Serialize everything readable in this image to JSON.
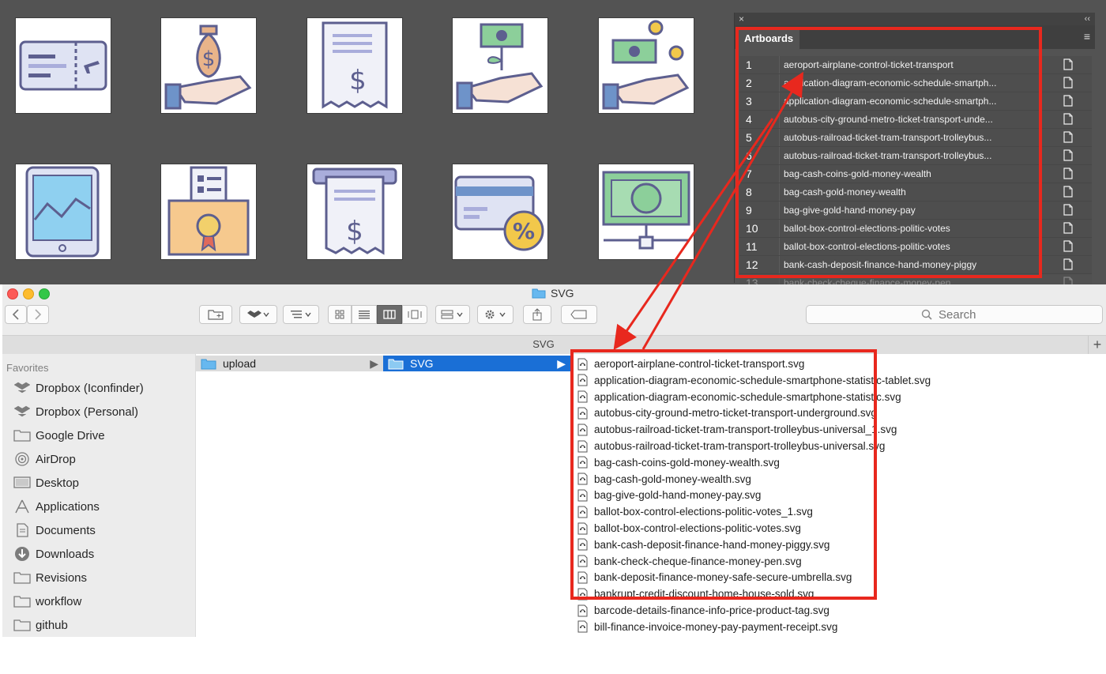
{
  "canvas": {
    "icons": [
      {
        "name": "airplane-ticket-icon"
      },
      {
        "name": "money-bag-hand-icon"
      },
      {
        "name": "receipt-dollar-icon"
      },
      {
        "name": "money-plant-hand-icon"
      },
      {
        "name": "cash-coins-hand-icon"
      },
      {
        "name": "tablet-chart-icon"
      },
      {
        "name": "ballot-box-icon"
      },
      {
        "name": "atm-receipt-icon"
      },
      {
        "name": "credit-card-percent-icon"
      },
      {
        "name": "banknote-icon"
      }
    ]
  },
  "artboards_panel": {
    "close_glyph": "×",
    "collapse_glyph": "‹‹",
    "tab_label": "Artboards",
    "menu_glyph": "≡",
    "rows": [
      {
        "num": "1",
        "name": "aeroport-airplane-control-ticket-transport"
      },
      {
        "num": "2",
        "name": "application-diagram-economic-schedule-smartph..."
      },
      {
        "num": "3",
        "name": "application-diagram-economic-schedule-smartph..."
      },
      {
        "num": "4",
        "name": "autobus-city-ground-metro-ticket-transport-unde..."
      },
      {
        "num": "5",
        "name": "autobus-railroad-ticket-tram-transport-trolleybus..."
      },
      {
        "num": "6",
        "name": "autobus-railroad-ticket-tram-transport-trolleybus..."
      },
      {
        "num": "7",
        "name": "bag-cash-coins-gold-money-wealth"
      },
      {
        "num": "8",
        "name": "bag-cash-gold-money-wealth"
      },
      {
        "num": "9",
        "name": "bag-give-gold-hand-money-pay"
      },
      {
        "num": "10",
        "name": "ballot-box-control-elections-politic-votes"
      },
      {
        "num": "11",
        "name": "ballot-box-control-elections-politic-votes"
      },
      {
        "num": "12",
        "name": "bank-cash-deposit-finance-hand-money-piggy"
      },
      {
        "num": "13",
        "name": "bank-check-cheque-finance-money-pen"
      }
    ]
  },
  "finder": {
    "window_title": "SVG",
    "path_label": "SVG",
    "search_placeholder": "Search",
    "plus_glyph": "+",
    "sidebar": {
      "header": "Favorites",
      "items": [
        {
          "label": "Dropbox (Iconfinder)",
          "icon": "dropbox-icon"
        },
        {
          "label": "Dropbox (Personal)",
          "icon": "dropbox-icon"
        },
        {
          "label": "Google Drive",
          "icon": "folder-icon"
        },
        {
          "label": "AirDrop",
          "icon": "airdrop-icon"
        },
        {
          "label": "Desktop",
          "icon": "desktop-icon"
        },
        {
          "label": "Applications",
          "icon": "applications-icon"
        },
        {
          "label": "Documents",
          "icon": "documents-icon"
        },
        {
          "label": "Downloads",
          "icon": "downloads-icon"
        },
        {
          "label": "Revisions",
          "icon": "folder-icon"
        },
        {
          "label": "workflow",
          "icon": "folder-icon"
        },
        {
          "label": "github",
          "icon": "folder-icon"
        }
      ]
    },
    "column1": {
      "label": "upload"
    },
    "column2": {
      "label": "SVG"
    },
    "files": [
      "aeroport-airplane-control-ticket-transport.svg",
      "application-diagram-economic-schedule-smartphone-statistic-tablet.svg",
      "application-diagram-economic-schedule-smartphone-statistic.svg",
      "autobus-city-ground-metro-ticket-transport-underground.svg",
      "autobus-railroad-ticket-tram-transport-trolleybus-universal_1.svg",
      "autobus-railroad-ticket-tram-transport-trolleybus-universal.svg",
      "bag-cash-coins-gold-money-wealth.svg",
      "bag-cash-gold-money-wealth.svg",
      "bag-give-gold-hand-money-pay.svg",
      "ballot-box-control-elections-politic-votes_1.svg",
      "ballot-box-control-elections-politic-votes.svg",
      "bank-cash-deposit-finance-hand-money-piggy.svg",
      "bank-check-cheque-finance-money-pen.svg",
      "bank-deposit-finance-money-safe-secure-umbrella.svg",
      "bankrupt-credit-discount-home-house-sold.svg",
      "barcode-details-finance-info-price-product-tag.svg",
      "bill-finance-invoice-money-pay-payment-receipt.svg"
    ]
  },
  "colors": {
    "annotation_red": "#e8281e",
    "selection_blue": "#1a6fd6",
    "icon_outline": "#5d5f8f"
  }
}
